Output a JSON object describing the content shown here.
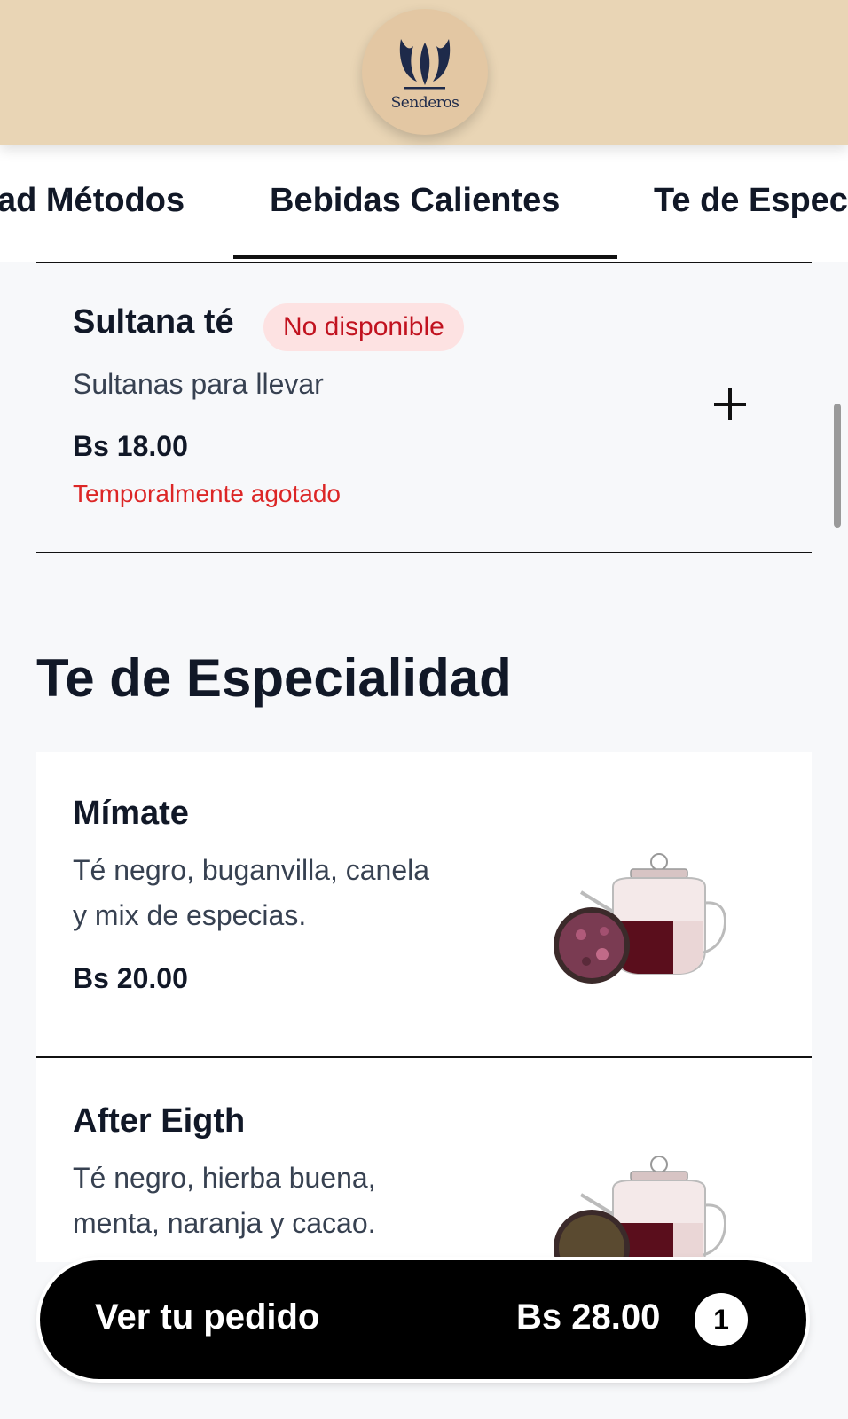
{
  "header": {
    "logo_text": "Senderos"
  },
  "tabs": [
    {
      "label": "ad Métodos"
    },
    {
      "label": "Bebidas Calientes",
      "active": true
    },
    {
      "label": "Te de Espec"
    }
  ],
  "items_top": [
    {
      "name": "Sultana té",
      "badge": "No disponible",
      "description": "Sultanas para llevar",
      "price": "Bs 18.00",
      "note": "Temporalmente agotado"
    }
  ],
  "section": {
    "title": "Te de Especialidad",
    "items": [
      {
        "name": "Mímate",
        "description_lines": [
          "Té negro, buganvilla, canela",
          "y mix de especias."
        ],
        "price": "Bs 20.00",
        "image": "teapot-with-loose-tea"
      },
      {
        "name": "After Eigth",
        "description_lines": [
          "Té negro, hierba buena,",
          "menta, naranja y cacao."
        ],
        "image": "teapot-with-loose-tea"
      }
    ]
  },
  "cart": {
    "label": "Ver tu pedido",
    "total": "Bs 28.00",
    "count": "1"
  },
  "colors": {
    "header_bg": "#e9d5b5",
    "logo_bg": "#e3c7a3",
    "badge_bg": "#fde2e2",
    "badge_text": "#c1121f",
    "out_of_stock": "#dc2626",
    "cart_bg": "#000000"
  }
}
